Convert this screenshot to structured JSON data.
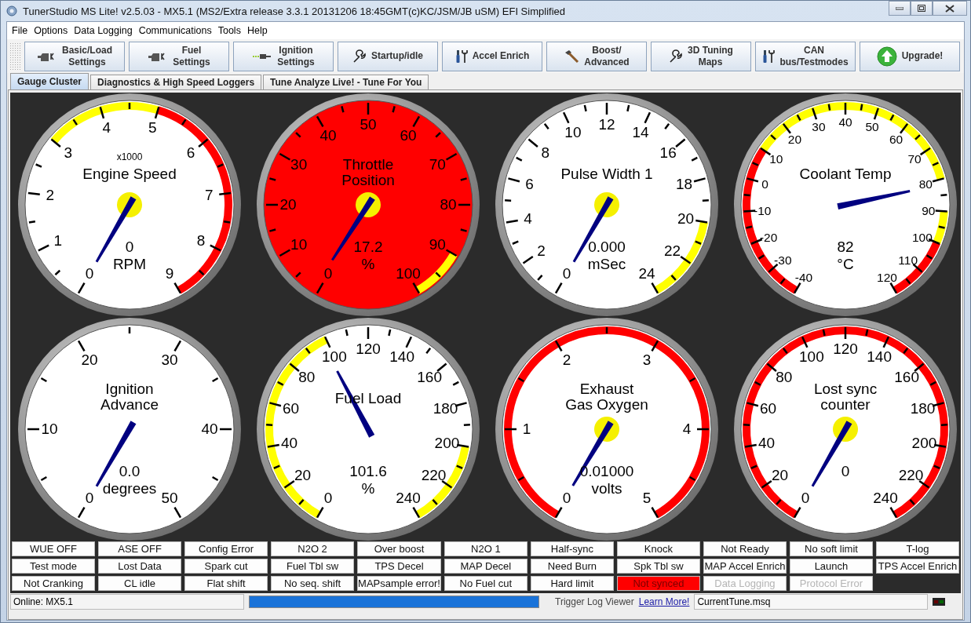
{
  "window": {
    "title": "TunerStudio MS Lite! v2.5.03 - MX5.1 (MS2/Extra release 3.3.1  20131206 18:45GMT(c)KC/JSM/JB   uSM) EFI Simplified"
  },
  "menu": [
    "File",
    "Options",
    "Data Logging",
    "Communications",
    "Tools",
    "Help"
  ],
  "toolbar": [
    {
      "kind": "engine",
      "lines": [
        "Basic/Load",
        "Settings"
      ]
    },
    {
      "kind": "engine",
      "lines": [
        "Fuel",
        "Settings"
      ]
    },
    {
      "kind": "spark",
      "lines": [
        "Ignition",
        "Settings"
      ]
    },
    {
      "kind": "wrench",
      "lines": [
        "Startup/idle"
      ]
    },
    {
      "kind": "tools",
      "lines": [
        "Accel Enrich"
      ]
    },
    {
      "kind": "hammer",
      "lines": [
        "Boost/",
        "Advanced"
      ]
    },
    {
      "kind": "wrench",
      "lines": [
        "3D Tuning",
        "Maps"
      ]
    },
    {
      "kind": "tools",
      "lines": [
        "CAN",
        "bus/Testmodes"
      ]
    },
    {
      "kind": "upgrade",
      "lines": [
        "Upgrade!"
      ]
    }
  ],
  "tabs": [
    {
      "label": "Gauge Cluster",
      "selected": true
    },
    {
      "label": "Diagnostics & High Speed Loggers",
      "selected": false
    },
    {
      "label": "Tune Analyze Live! - Tune For You",
      "selected": false
    }
  ],
  "gauges": [
    {
      "title": [
        "Engine Speed"
      ],
      "subtitle": "x1000",
      "value": "0",
      "units": "RPM",
      "alarm": false,
      "hub": true,
      "labels": [
        {
          "text": "0"
        },
        {
          "text": "1"
        },
        {
          "text": "2"
        },
        {
          "text": "3",
          "color": "#ffff00"
        },
        {
          "text": "4",
          "color": "#ffff00"
        },
        {
          "text": "5",
          "color": "#ff0000"
        },
        {
          "text": "6",
          "color": "#ff0000"
        },
        {
          "text": "7",
          "color": "#ff0000"
        },
        {
          "text": "8",
          "color": "#ff0000"
        },
        {
          "text": "9"
        }
      ]
    },
    {
      "title": [
        "Throttle",
        "Position"
      ],
      "value": "17.2",
      "units": "%",
      "alarm": true,
      "hub": true,
      "labels": [
        {
          "text": "0"
        },
        {
          "text": "10"
        },
        {
          "text": "20"
        },
        {
          "text": "30"
        },
        {
          "text": "40"
        },
        {
          "text": "50"
        },
        {
          "text": "60"
        },
        {
          "text": "70"
        },
        {
          "text": "80"
        },
        {
          "text": "90",
          "color": "#ffff00"
        },
        {
          "text": "100"
        }
      ]
    },
    {
      "title": [
        "Pulse Width 1"
      ],
      "value": "0.000",
      "units": "mSec",
      "alarm": false,
      "hub": true,
      "labels": [
        {
          "text": "0"
        },
        {
          "text": "2"
        },
        {
          "text": "4"
        },
        {
          "text": "6"
        },
        {
          "text": "8"
        },
        {
          "text": "10"
        },
        {
          "text": "12"
        },
        {
          "text": "14"
        },
        {
          "text": "16"
        },
        {
          "text": "18"
        },
        {
          "text": "20",
          "color": "#ffff00"
        },
        {
          "text": "22",
          "color": "#ffff00"
        },
        {
          "text": "24"
        }
      ]
    },
    {
      "title": [
        "Coolant Temp"
      ],
      "value": "82",
      "units": "°C",
      "alarm": false,
      "hub": false,
      "labels": [
        {
          "text": "-40",
          "color": "#ff0000"
        },
        {
          "text": "-30",
          "color": "#ff0000"
        },
        {
          "text": "-20",
          "color": "#ff0000"
        },
        {
          "text": "-10",
          "color": "#ff0000"
        },
        {
          "text": "0",
          "color": "#ff0000"
        },
        {
          "text": "10",
          "color": "#ffff00"
        },
        {
          "text": "20",
          "color": "#ffff00"
        },
        {
          "text": "30",
          "color": "#ffff00"
        },
        {
          "text": "40",
          "color": "#ffff00"
        },
        {
          "text": "50",
          "color": "#ffff00"
        },
        {
          "text": "60",
          "color": "#ffff00"
        },
        {
          "text": "70",
          "color": "#ffff00"
        },
        {
          "text": "80"
        },
        {
          "text": "90",
          "color": "#ffff00"
        },
        {
          "text": "100",
          "color": "#ff0000"
        },
        {
          "text": "110",
          "color": "#ff0000"
        },
        {
          "text": "120"
        }
      ]
    },
    {
      "title": [
        "Ignition",
        "Advance"
      ],
      "value": "0.0",
      "units": "degrees",
      "alarm": false,
      "hub": false,
      "labels": [
        {
          "text": "0"
        },
        {
          "text": "10"
        },
        {
          "text": "20"
        },
        {
          "text": "30"
        },
        {
          "text": "40"
        },
        {
          "text": "50"
        }
      ]
    },
    {
      "title": [
        "Fuel Load"
      ],
      "value": "101.6",
      "units": "%",
      "alarm": false,
      "hub": false,
      "labels": [
        {
          "text": "0",
          "color": "#ffff00"
        },
        {
          "text": "20",
          "color": "#ffff00"
        },
        {
          "text": "40",
          "color": "#ffff00"
        },
        {
          "text": "60",
          "color": "#ffff00"
        },
        {
          "text": "80",
          "color": "#ffff00"
        },
        {
          "text": "100"
        },
        {
          "text": "120"
        },
        {
          "text": "140"
        },
        {
          "text": "160"
        },
        {
          "text": "180"
        },
        {
          "text": "200",
          "color": "#ffff00"
        },
        {
          "text": "220",
          "color": "#ffff00"
        },
        {
          "text": "240"
        }
      ]
    },
    {
      "title": [
        "Exhaust",
        "Gas Oxygen"
      ],
      "value": "0.01000",
      "units": "volts",
      "alarm": false,
      "hub": true,
      "labels": [
        {
          "text": "0",
          "color": "#ff0000"
        },
        {
          "text": "1",
          "color": "#ff0000"
        },
        {
          "text": "2",
          "color": "#ff0000"
        },
        {
          "text": "3",
          "color": "#ff0000"
        },
        {
          "text": "4",
          "color": "#ff0000"
        },
        {
          "text": "5"
        }
      ]
    },
    {
      "title": [
        "Lost sync",
        "counter"
      ],
      "value": "0",
      "alarm": false,
      "hub": true,
      "labels": [
        {
          "text": "0",
          "color": "#ff0000"
        },
        {
          "text": "20",
          "color": "#ff0000"
        },
        {
          "text": "40",
          "color": "#ff0000"
        },
        {
          "text": "60",
          "color": "#ff0000"
        },
        {
          "text": "80",
          "color": "#ff0000"
        },
        {
          "text": "100",
          "color": "#ff0000"
        },
        {
          "text": "120",
          "color": "#ff0000"
        },
        {
          "text": "140",
          "color": "#ff0000"
        },
        {
          "text": "160",
          "color": "#ff0000"
        },
        {
          "text": "180",
          "color": "#ff0000"
        },
        {
          "text": "200",
          "color": "#ff0000"
        },
        {
          "text": "220",
          "color": "#ff0000"
        },
        {
          "text": "240"
        }
      ]
    }
  ],
  "indicators": [
    {
      "label": "WUE OFF",
      "on": false,
      "disabled": false
    },
    {
      "label": "ASE OFF",
      "on": false,
      "disabled": false
    },
    {
      "label": "Config Error",
      "on": false,
      "disabled": false
    },
    {
      "label": "N2O 2",
      "on": false,
      "disabled": false
    },
    {
      "label": "Over boost",
      "on": false,
      "disabled": false
    },
    {
      "label": "N2O 1",
      "on": false,
      "disabled": false
    },
    {
      "label": "Half-sync",
      "on": false,
      "disabled": false
    },
    {
      "label": "Knock",
      "on": false,
      "disabled": false
    },
    {
      "label": "Not Ready",
      "on": false,
      "disabled": false
    },
    {
      "label": "No soft limit",
      "on": false,
      "disabled": false
    },
    {
      "label": "T-log",
      "on": false,
      "disabled": false
    },
    {
      "label": "Test mode",
      "on": false,
      "disabled": false
    },
    {
      "label": "Lost Data",
      "on": false,
      "disabled": false
    },
    {
      "label": "Spark cut",
      "on": false,
      "disabled": false
    },
    {
      "label": "Fuel Tbl sw",
      "on": false,
      "disabled": false
    },
    {
      "label": "TPS Decel",
      "on": false,
      "disabled": false
    },
    {
      "label": "MAP Decel",
      "on": false,
      "disabled": false
    },
    {
      "label": "Need Burn",
      "on": false,
      "disabled": false
    },
    {
      "label": "Spk Tbl sw",
      "on": false,
      "disabled": false
    },
    {
      "label": "MAP Accel Enrich",
      "on": false,
      "disabled": false
    },
    {
      "label": "Launch",
      "on": false,
      "disabled": false
    },
    {
      "label": "TPS Accel Enrich",
      "on": false,
      "disabled": false
    },
    {
      "label": "Not Cranking",
      "on": false,
      "disabled": false
    },
    {
      "label": "CL idle",
      "on": false,
      "disabled": false
    },
    {
      "label": "Flat shift",
      "on": false,
      "disabled": false
    },
    {
      "label": "No seq. shift",
      "on": false,
      "disabled": false
    },
    {
      "label": "MAPsample error!",
      "on": false,
      "disabled": false
    },
    {
      "label": "No Fuel cut",
      "on": false,
      "disabled": false
    },
    {
      "label": "Hard limit",
      "on": false,
      "disabled": false
    },
    {
      "label": "Not synced",
      "on": true,
      "disabled": false
    },
    {
      "label": "Data Logging",
      "on": false,
      "disabled": true
    },
    {
      "label": "Protocol Error",
      "on": false,
      "disabled": true
    }
  ],
  "status_bar": {
    "connection": "Online: MX5.1",
    "progress": {
      "level": 1
    },
    "trigger_log": "Trigger Log Viewer",
    "link": "Learn More!",
    "tune_file": "CurrentTune.msq"
  }
}
